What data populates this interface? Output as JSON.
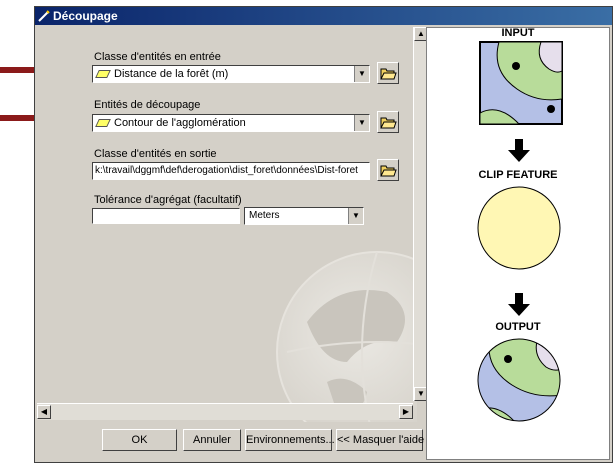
{
  "window": {
    "title": "Découpage"
  },
  "form": {
    "input_label": "Classe d'entités en entrée",
    "input_value": "Distance de la forêt (m)",
    "clip_label": "Entités de découpage",
    "clip_value": "Contour de l'agglomération",
    "output_label": "Classe d'entités en sortie",
    "output_value": "k:\\travail\\dggmf\\def\\derogation\\dist_foret\\données\\Dist-foret",
    "tolerance_label": "Tolérance d'agrégat (facultatif)",
    "tolerance_value": "",
    "units_value": "Meters"
  },
  "buttons": {
    "ok": "OK",
    "cancel": "Annuler",
    "environments": "Environnements...",
    "hide_help": "<< Masquer l'aide"
  },
  "help": {
    "input_title": "INPUT",
    "clip_title": "CLIP FEATURE",
    "output_title": "OUTPUT"
  },
  "colors": {
    "annotation_arrow": "#8b1a1a",
    "title_bar": "#0a246a",
    "map_blue": "#b4c0e6",
    "map_green": "#b8dc9a",
    "map_lavender": "#e6dfec",
    "clip_yellow": "#fff7b4"
  }
}
